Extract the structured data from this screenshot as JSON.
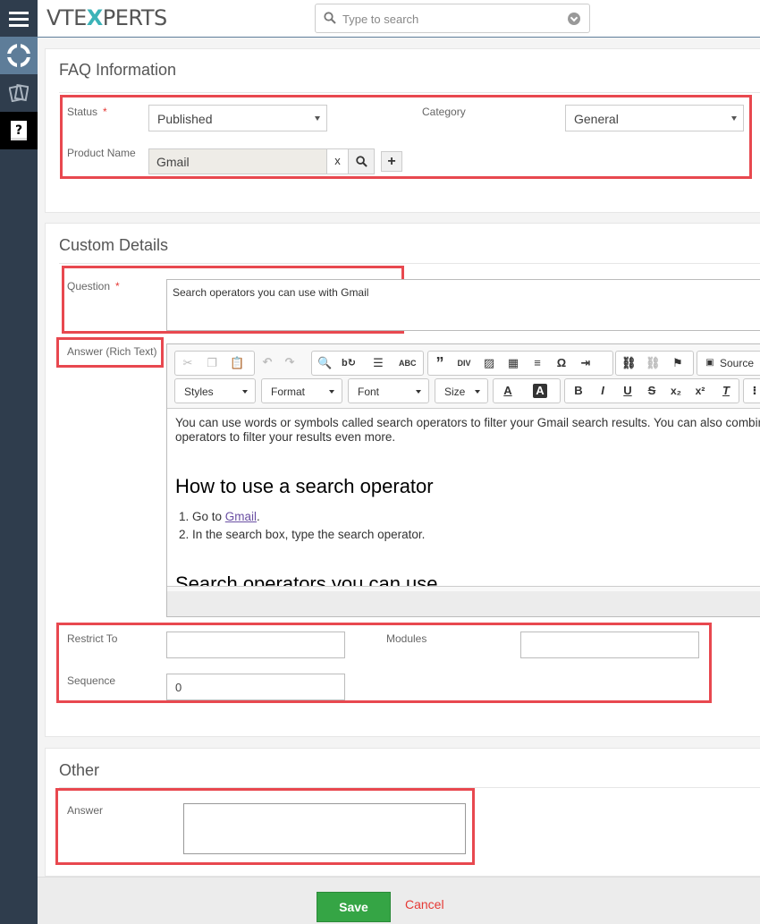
{
  "header": {
    "logo_left": "VTE",
    "logo_x": "X",
    "logo_right": "PERTS",
    "search_placeholder": "Type to search"
  },
  "sidebar": {
    "items": [
      {
        "icon": "hamburger-icon"
      },
      {
        "icon": "lifebuoy-icon"
      },
      {
        "icon": "tickets-icon"
      },
      {
        "icon": "faq-book-icon"
      }
    ]
  },
  "faq_info": {
    "title": "FAQ Information",
    "status_label": "Status",
    "status_value": "Published",
    "category_label": "Category",
    "category_value": "General",
    "product_label": "Product Name",
    "product_value": "Gmail",
    "clear_label": "x",
    "add_label": "+"
  },
  "custom": {
    "title": "Custom Details",
    "question_label": "Question",
    "question_value": "Search operators you can use with Gmail",
    "answer_label": "Answer (Rich Text)",
    "toolbar": {
      "source_label": "Source",
      "styles_label": "Styles",
      "format_label": "Format",
      "font_label": "Font",
      "size_label": "Size"
    },
    "content": {
      "paragraph": "You can use words or symbols called search operators to filter your Gmail search results. You can also combine operators to filter your results even more.",
      "heading1": "How to use a search operator",
      "step1_prefix": "Go to ",
      "step1_link": "Gmail",
      "step1_suffix": ".",
      "step2": "In the search box, type the search operator.",
      "heading2": "Search operators you can use"
    },
    "restrict_label": "Restrict To",
    "restrict_value": "",
    "modules_label": "Modules",
    "modules_value": "",
    "sequence_label": "Sequence",
    "sequence_value": "0"
  },
  "other": {
    "title": "Other",
    "answer_label": "Answer",
    "answer_value": ""
  },
  "footer": {
    "save_label": "Save",
    "cancel_label": "Cancel"
  },
  "colors": {
    "sidebar_bg": "#2f3d4d",
    "highlight_box": "#e8484f",
    "save_green": "#35a545",
    "cancel_red": "#e53935",
    "logo_accent": "#3bb3b8"
  }
}
